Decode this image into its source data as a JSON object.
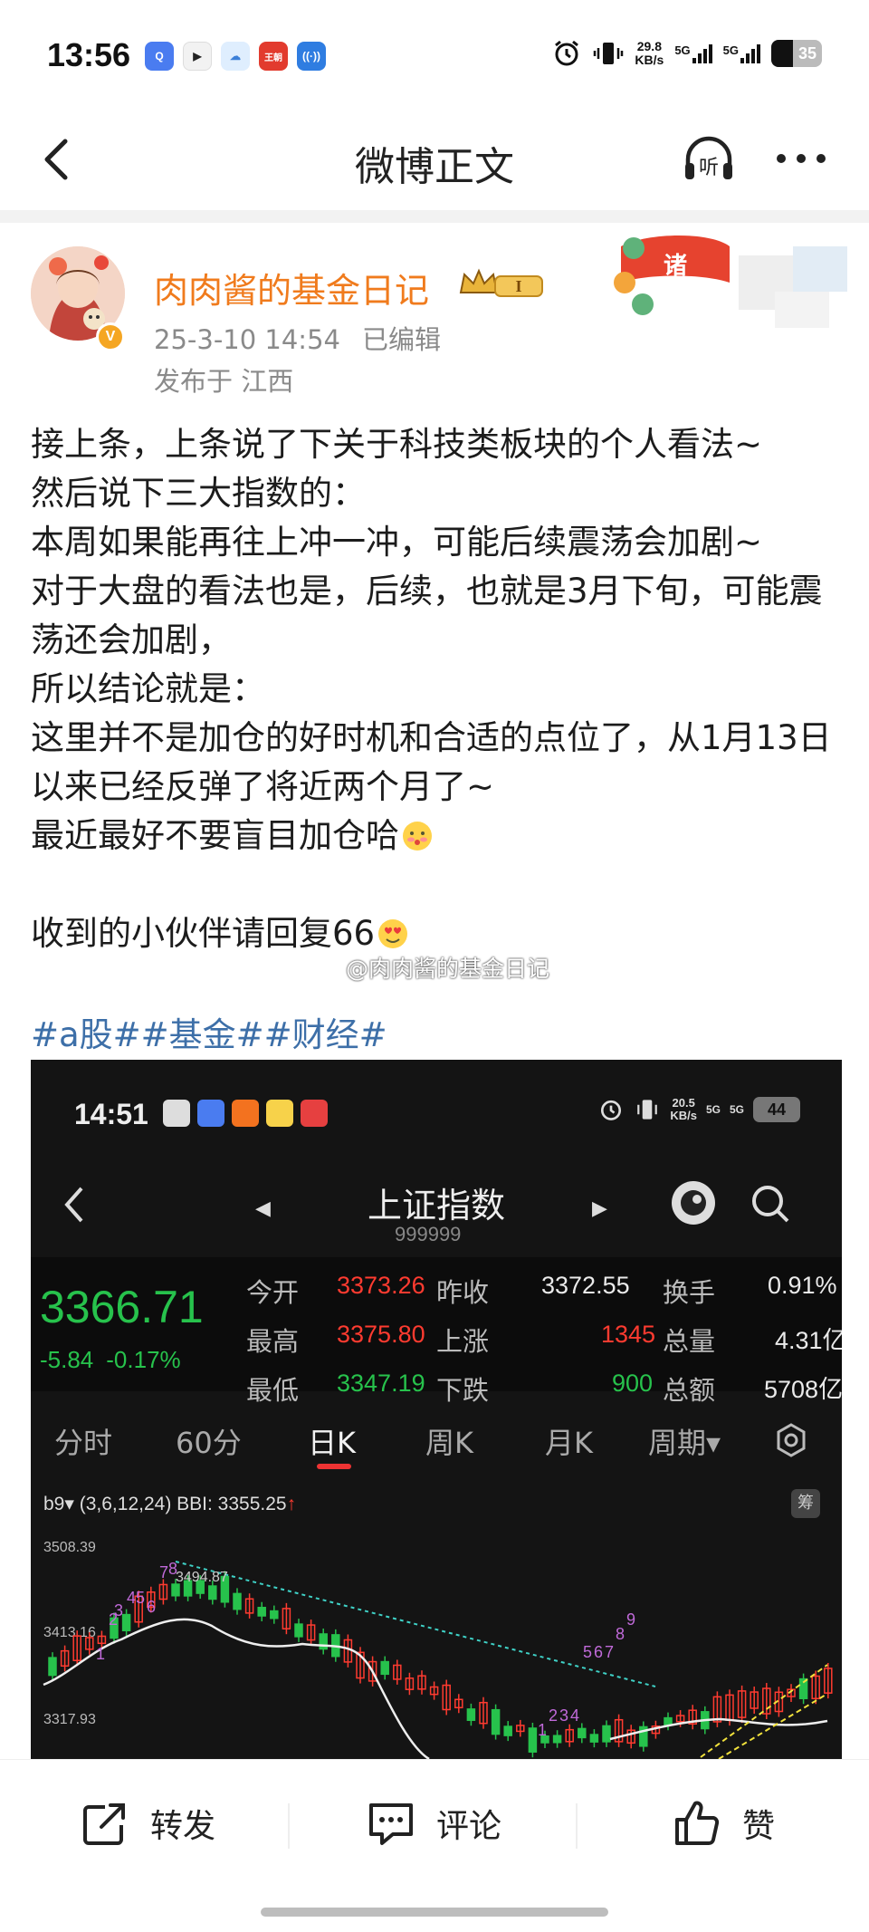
{
  "status_bar": {
    "time": "13:56",
    "speed_value": "29.8",
    "speed_unit": "KB/s",
    "net1": "5G",
    "net2": "5G",
    "battery": "35",
    "app_icons": [
      "search-app-icon",
      "video-app-icon",
      "weather-app-icon",
      "wangchao-app-icon",
      "nfc-app-icon"
    ],
    "wangchao_label": "王朝"
  },
  "nav": {
    "title": "微博正文",
    "listen_label": "听"
  },
  "post": {
    "username": "肉肉酱的基金日记",
    "level": "I",
    "date": "25-3-10 14:54",
    "edited": "已编辑",
    "location": "发布于 江西",
    "lines": [
      "接上条，上条说了下关于科技类板块的个人看法~",
      "然后说下三大指数的：",
      "本周如果能再往上冲一冲，可能后续震荡会加剧~",
      "对于大盘的看法也是，后续，也就是3月下旬，可能震荡还会加剧，",
      "所以结论就是：",
      "这里并不是加仓的好时机和合适的点位了，从1月13日以来已经反弹了将近两个月了~",
      "最近最好不要盲目加仓哈"
    ],
    "reply_line": "收到的小伙伴请回复66",
    "watermark": "@肉肉酱的基金日记",
    "tags": "#a股##基金##财经#"
  },
  "screenshot": {
    "time": "14:51",
    "speed_value": "20.5",
    "speed_unit": "KB/s",
    "net1": "5G",
    "net2": "5G",
    "battery": "44",
    "title": "上证指数",
    "code": "999999",
    "price": "3366.71",
    "change": "-5.84",
    "change_pct": "-0.17%",
    "quote": {
      "open_label": "今开",
      "open": "3373.26",
      "prev_label": "昨收",
      "prev": "3372.55",
      "turnover_label": "换手",
      "turnover": "0.91%",
      "high_label": "最高",
      "high": "3375.80",
      "up_label": "上涨",
      "up": "1345",
      "volume_label": "总量",
      "volume": "4.31亿",
      "low_label": "最低",
      "low": "3347.19",
      "down_label": "下跌",
      "down": "900",
      "amount_label": "总额",
      "amount": "5708亿"
    },
    "tabs": [
      "分时",
      "60分",
      "日K",
      "周K",
      "月K",
      "周期▾"
    ],
    "active_tab": "日K",
    "indicator_name": "b9▾",
    "indicator": "(3,6,12,24) BBI: 3355.25",
    "indicator_arrow": "↑",
    "chou_label": "筹",
    "y_labels": [
      "3508.39",
      "3413.16",
      "3317.93"
    ],
    "peak_label": "3494.87",
    "seq_labels": [
      "1",
      "2",
      "3",
      "4",
      "5",
      "6",
      "7",
      "8",
      "1",
      "2",
      "3",
      "4",
      "5",
      "6",
      "7",
      "8",
      "9"
    ]
  },
  "actions": {
    "repost": "转发",
    "comment": "评论",
    "like": "赞"
  },
  "colors": {
    "username": "#f07b1d",
    "tag": "#3d6fa8",
    "up_red": "#ff3b30",
    "down_green": "#27c24c"
  }
}
